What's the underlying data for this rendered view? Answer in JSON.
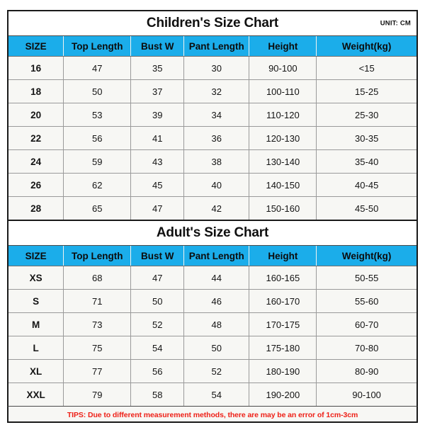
{
  "document": {
    "unit_label": "UNIT: CM",
    "accent_color": "#1badea",
    "tips_color": "#ee2118"
  },
  "columns": [
    "SIZE",
    "Top Length",
    "Bust W",
    "Pant Length",
    "Height",
    "Weight(kg)"
  ],
  "children_chart": {
    "title": "Children's Size Chart",
    "unit": "UNIT: CM",
    "headers": [
      "SIZE",
      "Top Length",
      "Bust W",
      "Pant Length",
      "Height",
      "Weight(kg)"
    ],
    "rows": [
      [
        "16",
        "47",
        "35",
        "30",
        "90-100",
        "<15"
      ],
      [
        "18",
        "50",
        "37",
        "32",
        "100-110",
        "15-25"
      ],
      [
        "20",
        "53",
        "39",
        "34",
        "110-120",
        "25-30"
      ],
      [
        "22",
        "56",
        "41",
        "36",
        "120-130",
        "30-35"
      ],
      [
        "24",
        "59",
        "43",
        "38",
        "130-140",
        "35-40"
      ],
      [
        "26",
        "62",
        "45",
        "40",
        "140-150",
        "40-45"
      ],
      [
        "28",
        "65",
        "47",
        "42",
        "150-160",
        "45-50"
      ]
    ]
  },
  "adult_chart": {
    "title": "Adult's Size Chart",
    "headers": [
      "SIZE",
      "Top Length",
      "Bust W",
      "Pant Length",
      "Height",
      "Weight(kg)"
    ],
    "rows": [
      [
        "XS",
        "68",
        "47",
        "44",
        "160-165",
        "50-55"
      ],
      [
        "S",
        "71",
        "50",
        "46",
        "160-170",
        "55-60"
      ],
      [
        "M",
        "73",
        "52",
        "48",
        "170-175",
        "60-70"
      ],
      [
        "L",
        "75",
        "54",
        "50",
        "175-180",
        "70-80"
      ],
      [
        "XL",
        "77",
        "56",
        "52",
        "180-190",
        "80-90"
      ],
      [
        "XXL",
        "79",
        "58",
        "54",
        "190-200",
        "90-100"
      ]
    ]
  },
  "footer": {
    "tips": "TIPS: Due to different measurement methods, there are may be an error of 1cm-3cm"
  }
}
